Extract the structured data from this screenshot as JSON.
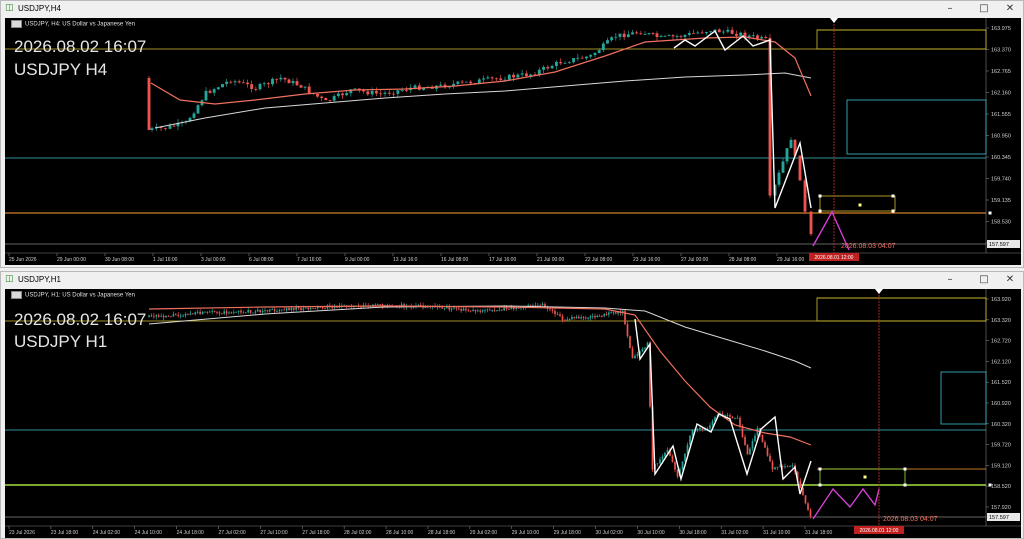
{
  "windows": [
    {
      "title": "USDJPY,H4",
      "header": "USDJPY, H4:  US Dollar vs Japanese Yen",
      "overlay_date": "2026.08.02 16:07",
      "overlay_symbol": "USDJPY H4",
      "price_labels": [
        "163.975",
        "163.370",
        "162.765",
        "162.160",
        "161.555",
        "160.950",
        "160.345",
        "159.740",
        "159.135",
        "158.530",
        "157.925"
      ],
      "current_price": "157.597",
      "time_labels": [
        "25 Jun 2026",
        "29 Jun 00:00",
        "30 Jun 08:00",
        "1 Jul 16:00",
        "3 Jul 00:00",
        "6 Jul 08:00",
        "7 Jul 16:00",
        "9 Jul 00:00",
        "13 Jul 16:0",
        "16 Jul 08:00",
        "17 Jul 16:00",
        "21 Jul 00:00",
        "22 Jul 08:00",
        "23 Jul 16:00",
        "27 Jul 00:00",
        "28 Jul 08:00",
        "29 Jul 16:00",
        "31 Jul 0"
      ],
      "time_marker": "2026.08.01 12:00",
      "forecast_label": "2026.08.03 04:07"
    },
    {
      "title": "USDJPY,H1",
      "header": "USDJPY, H1:  US Dollar vs Japanese Yen",
      "overlay_date": "2026.08.02 16:07",
      "overlay_symbol": "USDJPY H1",
      "price_labels": [
        "163.920",
        "163.320",
        "162.720",
        "162.120",
        "161.520",
        "160.920",
        "160.320",
        "159.720",
        "159.120",
        "158.520",
        "157.920"
      ],
      "current_price": "157.597",
      "time_labels": [
        "23 Jul 2026",
        "23 Jul 18:00",
        "24 Jul 02:00",
        "24 Jul 10:00",
        "24 Jul 18:00",
        "27 Jul 02:00",
        "27 Jul 10:00",
        "27 Jul 18:00",
        "28 Jul 02:00",
        "28 Jul 10:00",
        "28 Jul 18:00",
        "29 Jul 02:00",
        "29 Jul 10:00",
        "29 Jul 18:00",
        "30 Jul 02:00",
        "30 Jul 10:00",
        "30 Jul 18:00",
        "31 Jul 02:00",
        "31 Jul 10:00",
        "31 Jul 18:00"
      ],
      "time_marker": "2026.08.01 12:00",
      "forecast_label": "2026.08.03 04:07"
    }
  ],
  "colors": {
    "bull": "#26a69a",
    "bear": "#ef5350",
    "ma_fast": "#f07060",
    "ma_slow": "#d8d8d8",
    "zigzag": "#ffffff",
    "forecast": "#e040e0",
    "level_yellow": "#d8c030",
    "level_orange": "#ffa030",
    "level_cyan": "#40c0d0",
    "level_green": "#a0e040",
    "marker_red": "#d03030"
  },
  "icons": {
    "title_icon": "chart-window-icon",
    "minimize": "minimize-icon",
    "maximize": "maximize-icon",
    "close": "close-icon"
  }
}
